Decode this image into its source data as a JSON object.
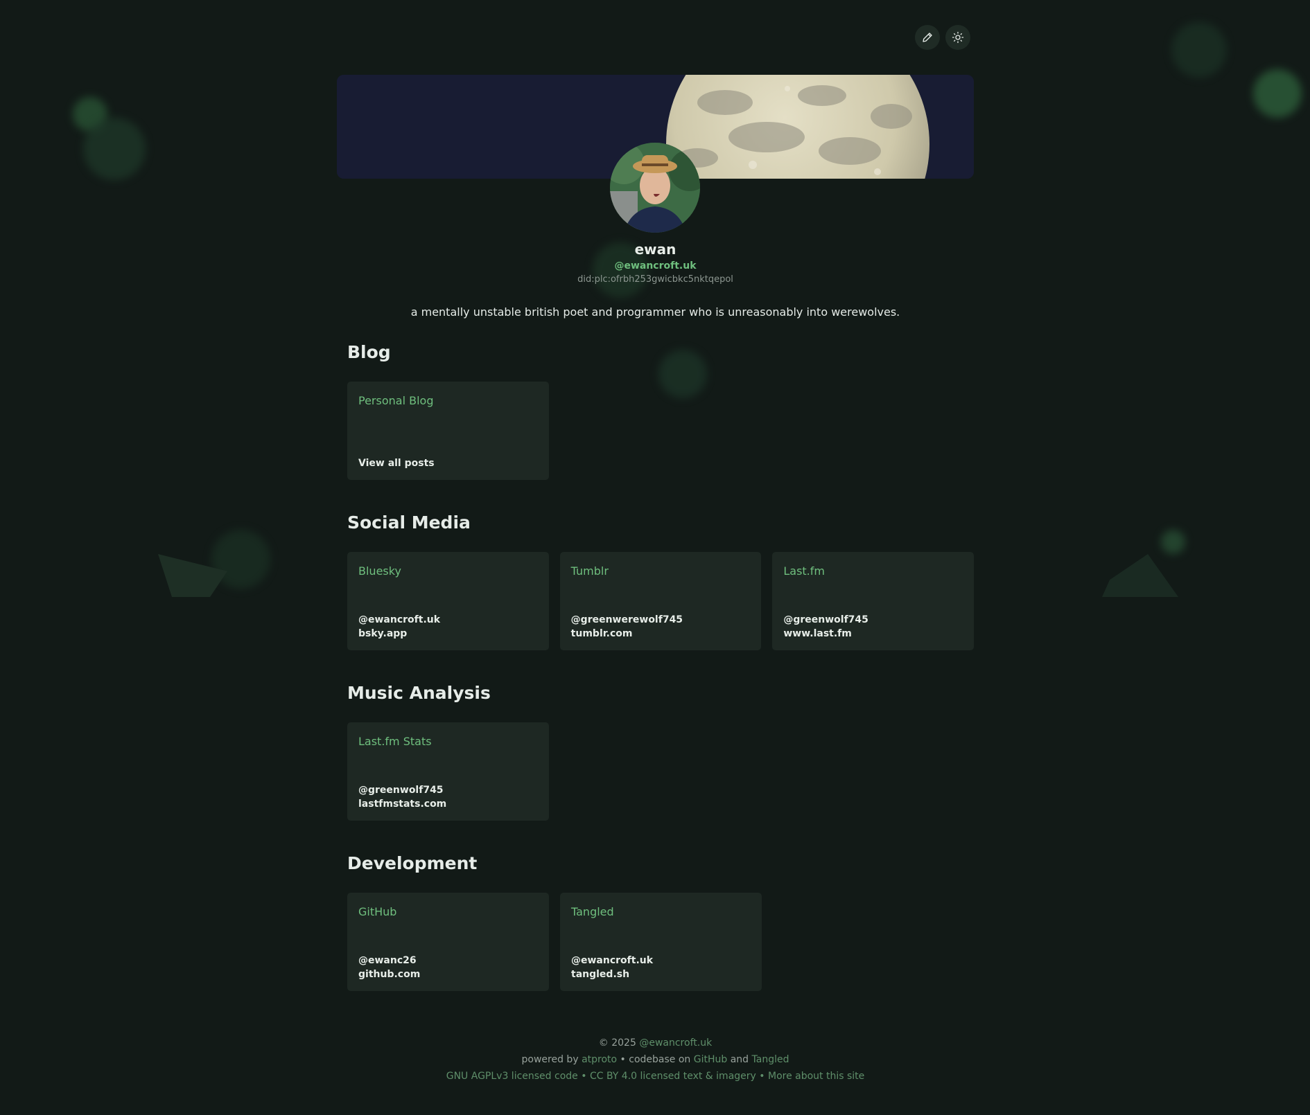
{
  "toolbar": {
    "edit_icon": "pencil-icon",
    "theme_icon": "sun-icon"
  },
  "profile": {
    "display_name": "ewan",
    "handle": "@ewancroft.uk",
    "did": "did:plc:ofrbh253gwicbkc5nktqepol",
    "bio": "a mentally unstable british poet and programmer who is unreasonably into werewolves."
  },
  "sections": {
    "blog": {
      "title": "Blog",
      "cards": [
        {
          "title": "Personal Blog",
          "line1": "View all posts",
          "line2": ""
        }
      ]
    },
    "social": {
      "title": "Social Media",
      "cards": [
        {
          "title": "Bluesky",
          "line1": "@ewancroft.uk",
          "line2": "bsky.app"
        },
        {
          "title": "Tumblr",
          "line1": "@greenwerewolf745",
          "line2": "tumblr.com"
        },
        {
          "title": "Last.fm",
          "line1": "@greenwolf745",
          "line2": "www.last.fm"
        }
      ]
    },
    "music": {
      "title": "Music Analysis",
      "cards": [
        {
          "title": "Last.fm Stats",
          "line1": "@greenwolf745",
          "line2": "lastfmstats.com"
        }
      ]
    },
    "dev": {
      "title": "Development",
      "cards": [
        {
          "title": "GitHub",
          "line1": "@ewanc26",
          "line2": "github.com"
        },
        {
          "title": "Tangled",
          "line1": "@ewancroft.uk",
          "line2": "tangled.sh"
        }
      ]
    }
  },
  "footer": {
    "copyright": "© 2025",
    "copyright_link": "@ewancroft.uk",
    "powered_by": "powered by",
    "atproto": "atproto",
    "sep1": "•",
    "codebase_on": "codebase on",
    "github": "GitHub",
    "and": "and",
    "tangled": "Tangled",
    "license_code": "GNU AGPLv3 licensed code",
    "sep2": "•",
    "license_text": "CC BY 4.0 licensed text & imagery",
    "sep3": "•",
    "more_about": "More about this site"
  },
  "colors": {
    "background": "#121a17",
    "card": "#1e2823",
    "accent": "#6fbf7e",
    "footer_link": "#5f8f6a",
    "banner_sky": "#181c33"
  }
}
